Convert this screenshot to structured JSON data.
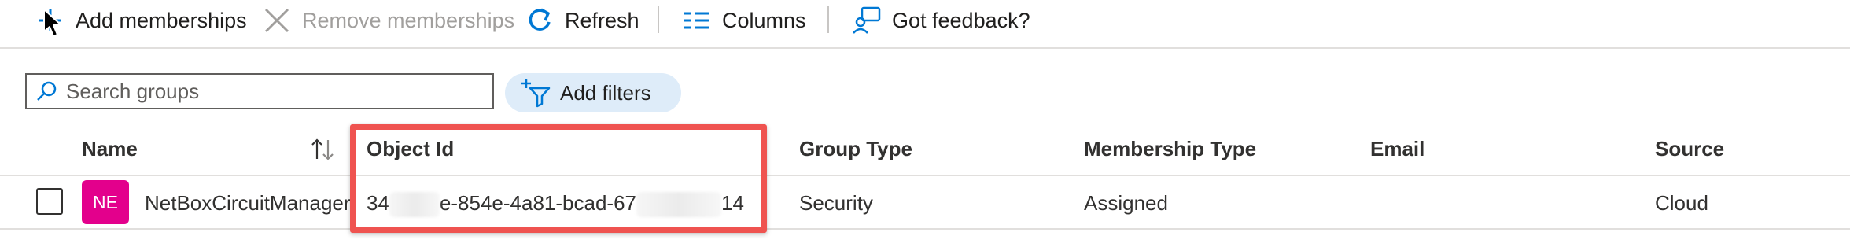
{
  "toolbar": {
    "add_memberships": "Add memberships",
    "remove_memberships": "Remove memberships",
    "refresh": "Refresh",
    "columns": "Columns",
    "feedback": "Got feedback?"
  },
  "search": {
    "placeholder": "Search groups"
  },
  "filters": {
    "label": "Add filters"
  },
  "table": {
    "headers": {
      "name": "Name",
      "object_id": "Object Id",
      "group_type": "Group Type",
      "membership_type": "Membership Type",
      "email": "Email",
      "source": "Source"
    },
    "rows": [
      {
        "avatar": "NE",
        "name": "NetBoxCircuitManager",
        "object_id_start": "34",
        "object_id_middle": "e-854e-4a81-bcad-67",
        "object_id_end": "14",
        "group_type": "Security",
        "membership_type": "Assigned",
        "email": "",
        "source": "Cloud"
      }
    ]
  },
  "colors": {
    "accent": "#0078d4",
    "avatar": "#e3008c",
    "highlight": "#ef5350",
    "filter_pill": "#deecf9"
  },
  "icons": [
    "add-icon",
    "close-icon",
    "refresh-icon",
    "columns-icon",
    "feedback-icon",
    "search-icon",
    "filter-icon",
    "sort-icon",
    "mouse-cursor-icon"
  ]
}
